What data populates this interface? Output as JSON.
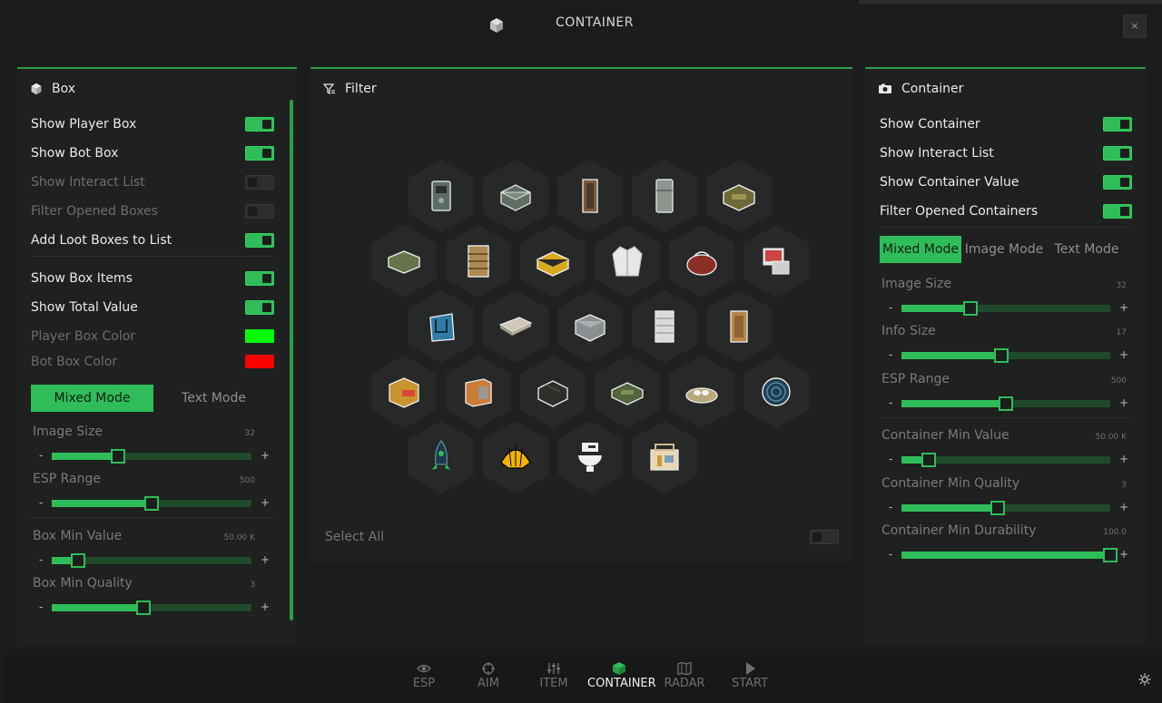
{
  "window": {
    "title": "CONTAINER",
    "close_label": "×"
  },
  "colors": {
    "accent": "#2ebd58",
    "player_box": "#00ff00",
    "bot_box": "#ff0000"
  },
  "box_panel": {
    "title": "Box",
    "toggles": [
      {
        "label": "Show Player Box",
        "on": true,
        "dim": false
      },
      {
        "label": "Show Bot Box",
        "on": true,
        "dim": false
      },
      {
        "label": "Show Interact List",
        "on": false,
        "dim": true
      },
      {
        "label": "Filter Opened Boxes",
        "on": false,
        "dim": true
      },
      {
        "label": "Add Loot Boxes to List",
        "on": true,
        "dim": false
      },
      {
        "label": "Show Box Items",
        "on": true,
        "dim": false
      },
      {
        "label": "Show Total Value",
        "on": true,
        "dim": false
      }
    ],
    "colors": [
      {
        "label": "Player Box Color",
        "color": "#00ff00"
      },
      {
        "label": "Bot Box Color",
        "color": "#ff0000"
      }
    ],
    "modes": [
      "Mixed Mode",
      "Text Mode"
    ],
    "active_mode": "Mixed Mode",
    "sliders": [
      {
        "label": "Image Size",
        "value": "32",
        "fraction": 0.33
      },
      {
        "label": "ESP Range",
        "value": "500",
        "fraction": 0.5
      },
      {
        "label": "Box Min Value",
        "value": "50.00 K",
        "fraction": 0.13
      },
      {
        "label": "Box Min Quality",
        "value": "3",
        "fraction": 0.46
      }
    ]
  },
  "filter_panel": {
    "title": "Filter",
    "select_all_label": "Select All",
    "items": [
      "safe-icon",
      "weapon-crate-icon",
      "locker-icon",
      "fridge-icon",
      "ammo-crate-icon",
      "military-box-icon",
      "drawer-cabinet-icon",
      "toolbox-icon",
      "jacket-icon",
      "duffel-bag-icon",
      "computer-icon",
      "trash-bin-icon",
      "suitcase-icon",
      "metal-crate-icon",
      "medical-cabinet-icon",
      "file-cabinet-icon",
      "cardboard-box-icon",
      "wall-safe-icon",
      "black-crate-icon",
      "green-case-icon",
      "bird-nest-icon",
      "manhole-icon",
      "rocket-icon",
      "shell-icon",
      "toilet-icon",
      "cooler-box-icon"
    ]
  },
  "container_panel": {
    "title": "Container",
    "toggles": [
      {
        "label": "Show Container",
        "on": true
      },
      {
        "label": "Show Interact List",
        "on": true
      },
      {
        "label": "Show Container Value",
        "on": true
      },
      {
        "label": "Filter Opened Containers",
        "on": true
      }
    ],
    "modes": [
      "Mixed Mode",
      "Image Mode",
      "Text Mode"
    ],
    "active_mode": "Mixed Mode",
    "sliders": [
      {
        "label": "Image Size",
        "value": "32",
        "fraction": 0.33
      },
      {
        "label": "Info Size",
        "value": "17",
        "fraction": 0.48
      },
      {
        "label": "ESP Range",
        "value": "500",
        "fraction": 0.5
      },
      {
        "label": "Container Min Value",
        "value": "50.00 K",
        "fraction": 0.13
      },
      {
        "label": "Container Min Quality",
        "value": "3",
        "fraction": 0.46
      },
      {
        "label": "Container Min Durability",
        "value": "100.0",
        "fraction": 1.0
      }
    ]
  },
  "nav": {
    "items": [
      {
        "label": "ESP",
        "icon": "eye-icon"
      },
      {
        "label": "AIM",
        "icon": "crosshair-icon"
      },
      {
        "label": "ITEM",
        "icon": "sliders-icon"
      },
      {
        "label": "CONTAINER",
        "icon": "cube-icon"
      },
      {
        "label": "RADAR",
        "icon": "map-icon"
      },
      {
        "label": "START",
        "icon": "play-icon"
      }
    ],
    "active": "CONTAINER"
  }
}
